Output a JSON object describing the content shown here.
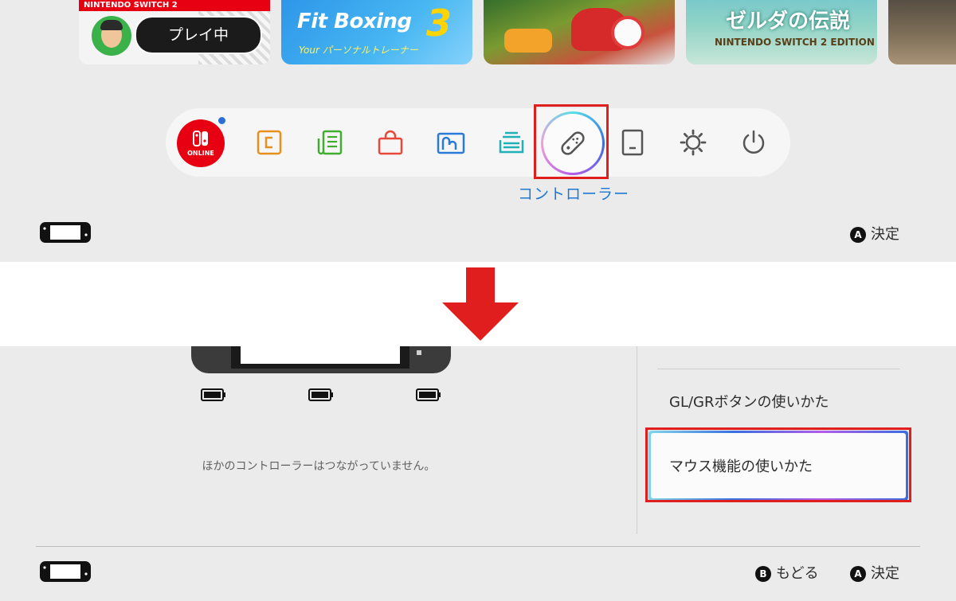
{
  "game_tiles": [
    {
      "title": "NINTENDO SWITCH 2",
      "badge": "プレイ中"
    },
    {
      "title": "Fit Boxing",
      "number": "3",
      "subtitle": "Your パーソナルトレーナー"
    },
    {
      "title": ""
    },
    {
      "title": "ゼルダの伝説",
      "subtitle": "NINTENDO SWITCH 2 EDITION"
    },
    {
      "title": ""
    }
  ],
  "dock": {
    "online_label": "ONLINE",
    "selected_label": "コントローラー",
    "icons": [
      "nintendo-switch-online-icon",
      "gamechat-icon",
      "news-icon",
      "eshop-icon",
      "album-icon",
      "gamecard-icon",
      "controller-icon",
      "virtual-card-icon",
      "settings-icon",
      "power-icon"
    ]
  },
  "top_hints": {
    "a_key": "A",
    "a_label": "決定"
  },
  "controller_screen": {
    "status_text": "ほかのコントローラーはつながっていません。",
    "menu": [
      {
        "label": "GL/GRボタンの使いかた",
        "selected": false
      },
      {
        "label": "マウス機能の使いかた",
        "selected": true
      }
    ]
  },
  "bottom_hints": {
    "b_key": "B",
    "b_label": "もどる",
    "a_key": "A",
    "a_label": "決定"
  },
  "colors": {
    "highlight_red": "#e01e1e",
    "accent_blue": "#1e78d2",
    "online_red": "#e60012"
  }
}
